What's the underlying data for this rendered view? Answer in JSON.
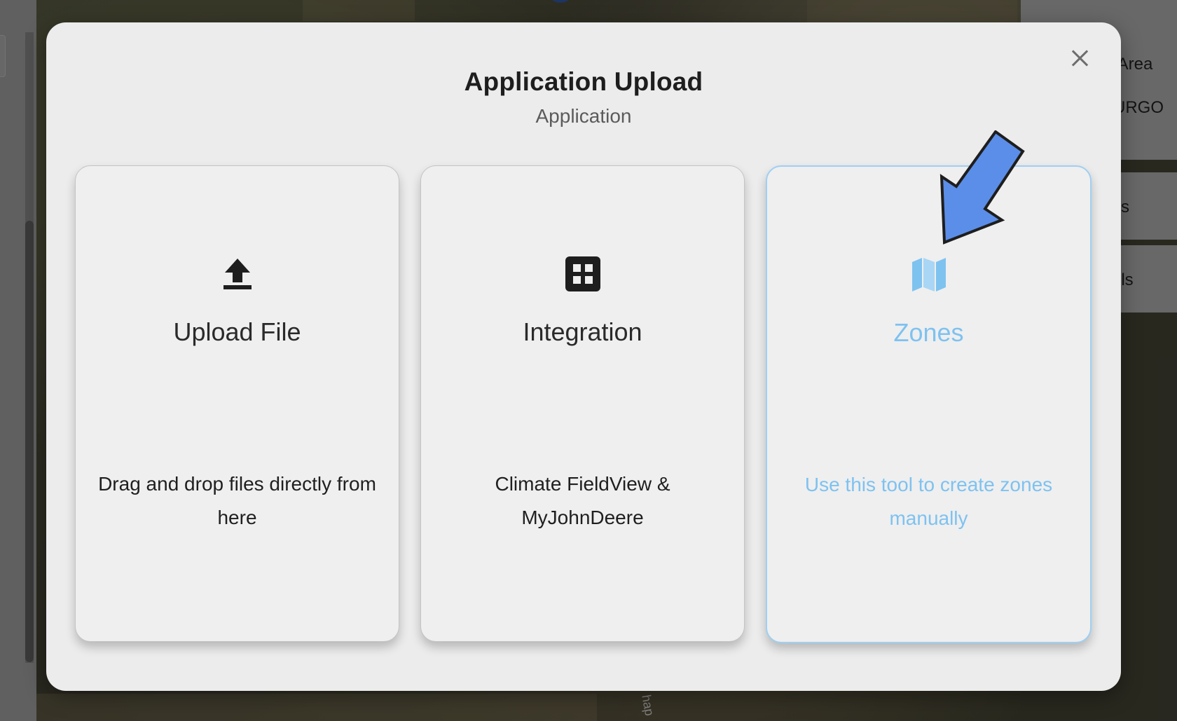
{
  "background": {
    "map_label": "hap",
    "right_panel": {
      "rows": [
        {
          "text": "l Area"
        },
        {
          "text": "URGO"
        },
        {
          "text": "s"
        },
        {
          "text": "ils"
        }
      ]
    }
  },
  "modal": {
    "title": "Application Upload",
    "subtitle": "Application",
    "close_icon": "close-icon",
    "options": [
      {
        "icon": "upload-icon",
        "title": "Upload File",
        "description": "Drag and drop files directly from here"
      },
      {
        "icon": "grid-icon",
        "title": "Integration",
        "description": "Climate FieldView & MyJohnDeere"
      },
      {
        "icon": "map-icon",
        "title": "Zones",
        "description": "Use this tool to create zones manually",
        "highlighted": true
      }
    ]
  },
  "colors": {
    "accent": "#7ec2f0",
    "arrow": "#5b8ee8",
    "modal_bg": "#ececec",
    "card_bg": "#efefef"
  }
}
